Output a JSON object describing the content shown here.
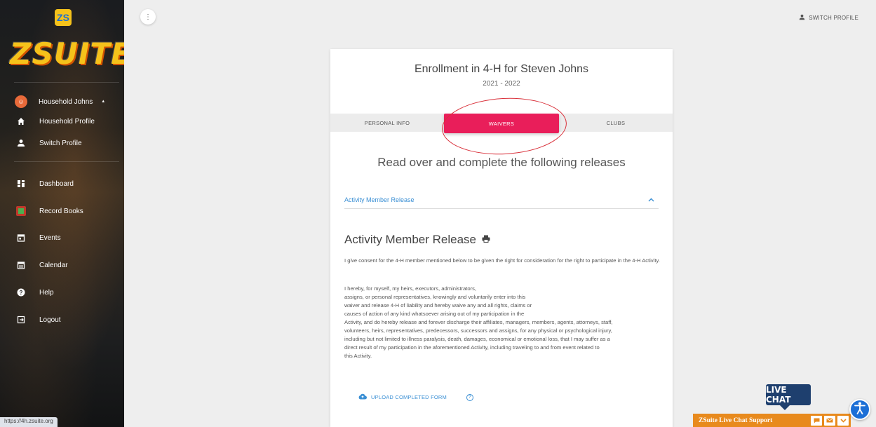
{
  "sidebar": {
    "logo_badge": "ZS",
    "logo_text": "ZSUITE",
    "household": {
      "label": "Household Johns",
      "caret": "▲"
    },
    "items": [
      {
        "label": "Household Profile",
        "icon": "home-icon"
      },
      {
        "label": "Switch Profile",
        "icon": "person-icon"
      },
      {
        "label": "Dashboard",
        "icon": "dashboard-icon"
      },
      {
        "label": "Record Books",
        "icon": "record-book-icon"
      },
      {
        "label": "Events",
        "icon": "event-icon"
      },
      {
        "label": "Calendar",
        "icon": "calendar-icon"
      },
      {
        "label": "Help",
        "icon": "help-icon"
      },
      {
        "label": "Logout",
        "icon": "logout-icon"
      }
    ]
  },
  "status_url": "https://4h.zsuite.org",
  "header": {
    "switch_profile": "SWITCH PROFILE"
  },
  "enrollment": {
    "title": "Enrollment in 4-H for Steven Johns",
    "year": "2021 - 2022",
    "tabs": [
      {
        "label": "PERSONAL INFO",
        "active": false
      },
      {
        "label": "WAIVERS",
        "active": true
      },
      {
        "label": "CLUBS",
        "active": false
      }
    ],
    "instructions": "Read over and complete the following releases",
    "accordion_label": "Activity Member Release",
    "release_title": "Activity Member Release",
    "paragraph1": "I give consent for the 4-H member mentioned below to be given the right for consideration for the right to participate in the 4-H Activity.",
    "paragraph2_lines": [
      "I hereby, for myself, my heirs, executors, administrators,",
      "assigns, or personal representatives, knowingly and voluntarily enter into this",
      "waiver and release 4-H of liability and hereby waive any and all rights, claims or",
      "causes of action of any kind whatsoever arising out of my participation in the",
      "Activity, and do hereby release and forever discharge their affiliates, managers, members, agents, attorneys, staff,",
      "volunteers, heirs, representatives, predecessors, successors and assigns, for any physical or psychological injury,",
      "including but not limited to illness paralysis, death, damages, economical or emotional loss, that I may suffer as a",
      "direct result of my participation in the aforementioned Activity, including traveling to and from event related to",
      "this Activity."
    ],
    "upload_label": "UPLOAD COMPLETED FORM"
  },
  "live_chat": {
    "bubble": "LIVE CHAT",
    "bar_label": "ZSuite Live Chat Support"
  },
  "colors": {
    "accent": "#e91e5a",
    "link": "#3a8fd4",
    "chat_bar": "#e88a1d",
    "chat_bubble": "#1e3f6e"
  }
}
